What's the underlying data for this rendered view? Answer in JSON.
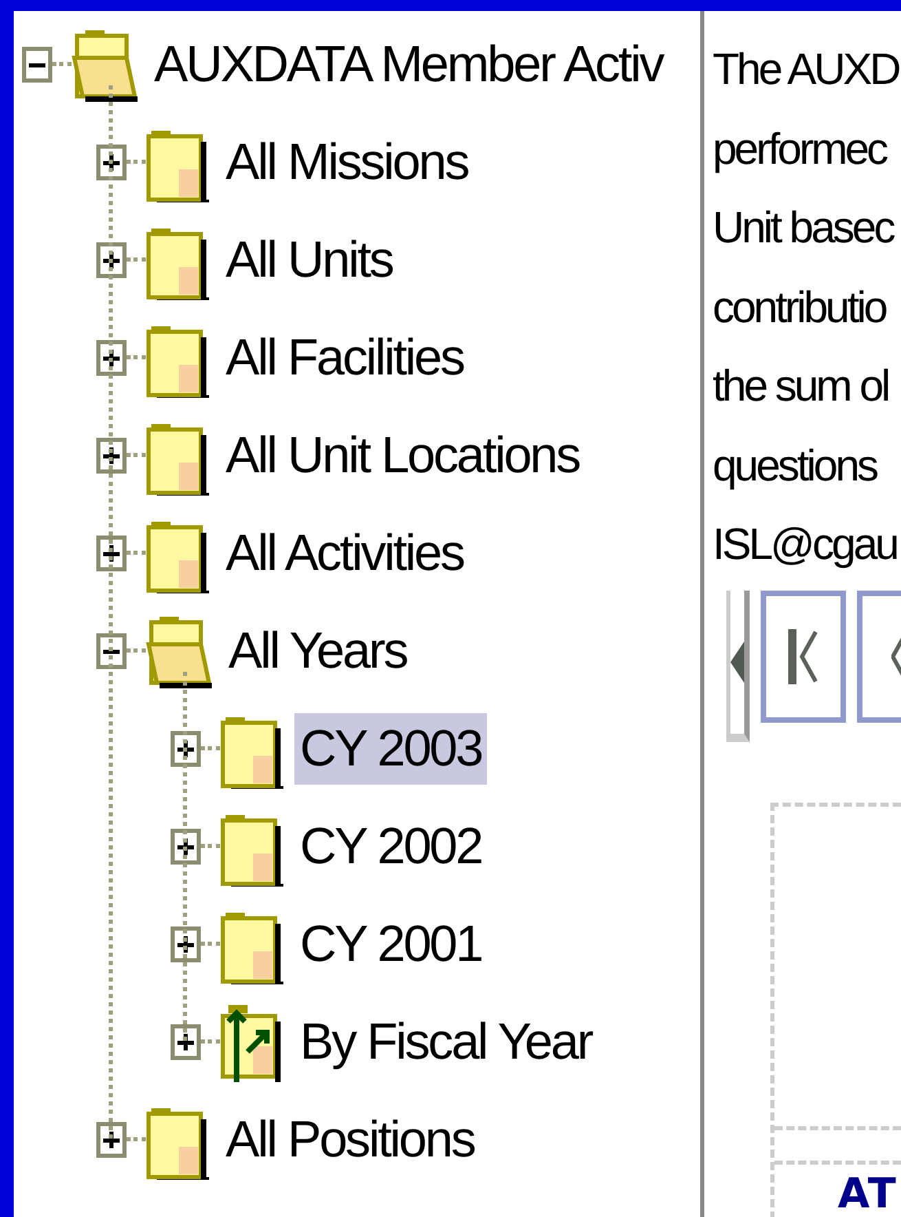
{
  "tree": [
    {
      "label": "AUXDATA Member Activ",
      "kind": "open-folder",
      "expanded": true,
      "selected": false,
      "children": [
        {
          "label": "All Missions",
          "kind": "folder",
          "expanded": false,
          "selected": false
        },
        {
          "label": "All Units",
          "kind": "folder",
          "expanded": false,
          "selected": false
        },
        {
          "label": "All Facilities",
          "kind": "folder",
          "expanded": false,
          "selected": false
        },
        {
          "label": "All Unit Locations",
          "kind": "folder",
          "expanded": false,
          "selected": false
        },
        {
          "label": "All Activities",
          "kind": "folder",
          "expanded": false,
          "selected": false
        },
        {
          "label": "All Years",
          "kind": "open-folder",
          "expanded": true,
          "selected": false,
          "children": [
            {
              "label": "CY 2003",
              "kind": "folder",
              "expanded": false,
              "selected": true
            },
            {
              "label": "CY 2002",
              "kind": "folder",
              "expanded": false,
              "selected": false
            },
            {
              "label": "CY 2001",
              "kind": "folder",
              "expanded": false,
              "selected": false
            },
            {
              "label": "By Fiscal Year",
              "kind": "arrow-folder",
              "expanded": false,
              "selected": false
            }
          ]
        },
        {
          "label": "All Positions",
          "kind": "folder",
          "expanded": false,
          "selected": false
        }
      ]
    }
  ],
  "description": [
    "The AUXD",
    "performec",
    "Unit basec",
    "contributio",
    "the sum ol",
    "questions",
    "ISL@cgau"
  ],
  "report": {
    "heading": "AT"
  }
}
